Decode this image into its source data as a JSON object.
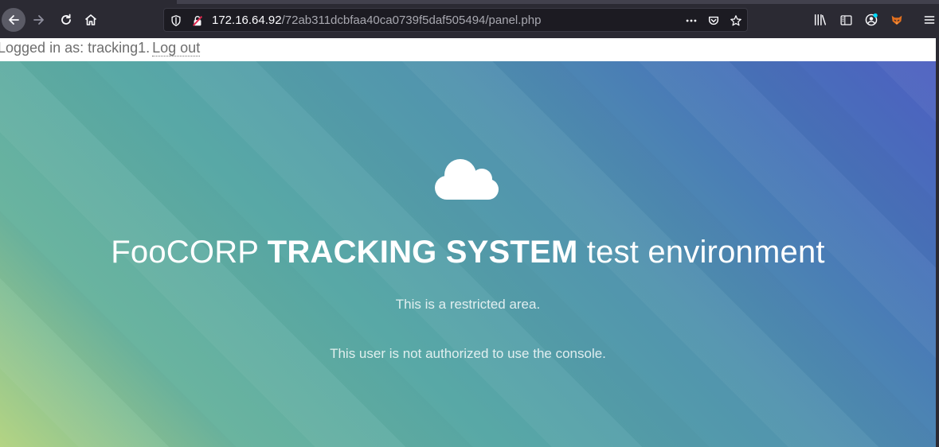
{
  "browser": {
    "url_host": "172.16.64.92",
    "url_path": "/72ab311dcbfaa40ca0739f5daf505494/panel.php",
    "icons": {
      "back": "back-arrow-icon",
      "forward": "forward-arrow-icon",
      "reload": "reload-icon",
      "home": "home-icon",
      "shield": "tracking-protection-shield-icon",
      "insecure": "insecure-lock-icon",
      "more": "page-actions-ellipsis-icon",
      "pocket": "pocket-icon",
      "bookmark": "bookmark-star-icon",
      "library": "library-icon",
      "sidebar": "sidebar-icon",
      "account": "account-icon",
      "extension": "fox-extension-icon",
      "menu": "hamburger-menu-icon"
    },
    "colors": {
      "toolbar": "#2b2a33",
      "urlbar": "#1c1b22",
      "accent": "#00ddff"
    }
  },
  "page": {
    "login_text": "Logged in as: tracking1.",
    "logout_label": "Log out",
    "hero": {
      "icon": "cloud-icon",
      "title_prefix": "FooCORP",
      "title_bold": "TRACKING SYSTEM",
      "title_suffix": "test environment",
      "line1": "This is a restricted area.",
      "line2": "This user is not authorized to use the console."
    }
  }
}
